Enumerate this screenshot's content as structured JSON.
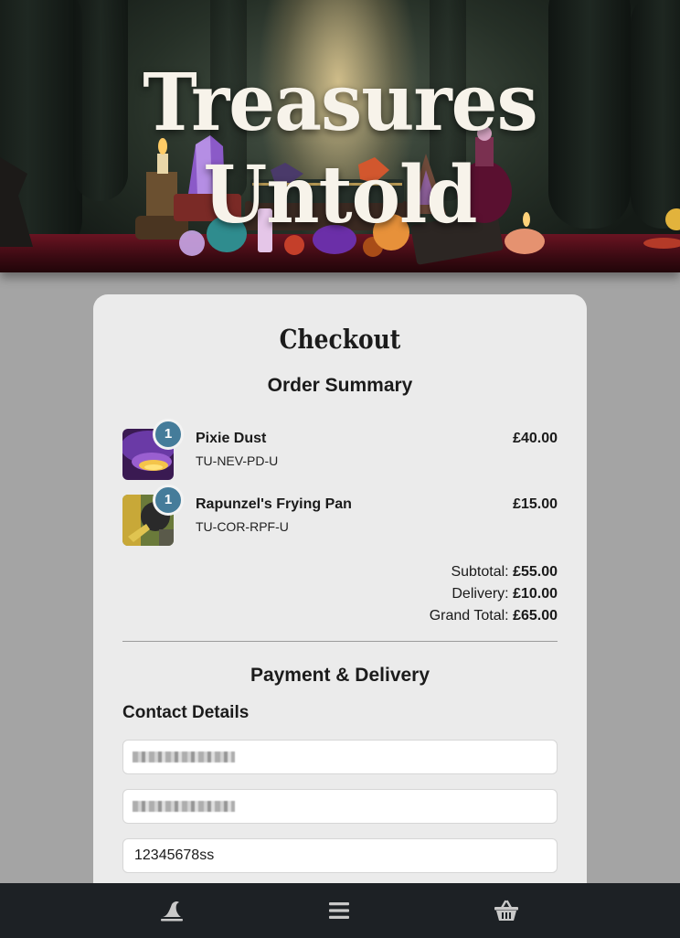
{
  "hero": {
    "title": "Treasures Untold"
  },
  "checkout": {
    "title": "Checkout",
    "order_summary_title": "Order Summary",
    "items": [
      {
        "qty": "1",
        "name": "Pixie Dust",
        "sku": "TU-NEV-PD-U",
        "price": "£40.00"
      },
      {
        "qty": "1",
        "name": "Rapunzel's Frying Pan",
        "sku": "TU-COR-RPF-U",
        "price": "£15.00"
      }
    ],
    "totals": {
      "subtotal_label": "Subtotal:",
      "subtotal": "£55.00",
      "delivery_label": "Delivery:",
      "delivery": "£10.00",
      "grand_label": "Grand Total:",
      "grand": "£65.00"
    },
    "payment_title": "Payment & Delivery",
    "contact_title": "Contact Details",
    "phone_value": "12345678ss"
  },
  "nav": {
    "home_icon": "wizard-hat-icon",
    "menu_icon": "menu-icon",
    "basket_icon": "basket-icon"
  },
  "colors": {
    "badge": "#457c9a",
    "nav_bg": "#1d2125",
    "page_bg": "#a4a4a4",
    "card_bg": "#ebebeb"
  }
}
